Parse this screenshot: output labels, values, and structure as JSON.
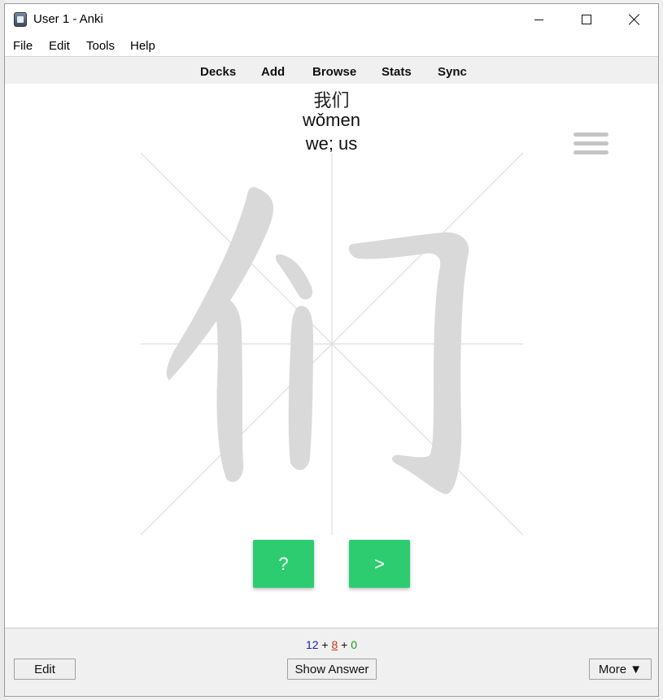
{
  "window": {
    "title": "User 1 - Anki",
    "app_icon": "anki-icon"
  },
  "menu": [
    "File",
    "Edit",
    "Tools",
    "Help"
  ],
  "toolbar": [
    "Decks",
    "Add",
    "Browse",
    "Stats",
    "Sync"
  ],
  "card": {
    "hanzi": "我们",
    "pinyin": "wǒmen",
    "meaning": "we; us",
    "writer_character": "们",
    "hint_button": "?",
    "next_button": ">"
  },
  "counts": {
    "new": "12",
    "sep1": " + ",
    "learning": "8",
    "sep2": " + ",
    "review": "0"
  },
  "buttons": {
    "edit": "Edit",
    "show_answer": "Show Answer",
    "more": "More ▼"
  },
  "colors": {
    "quiz_green": "#2ecc71",
    "new_count": "#1a1aaa",
    "learning_count": "#c5391c",
    "review_count": "#1a9a1a"
  }
}
